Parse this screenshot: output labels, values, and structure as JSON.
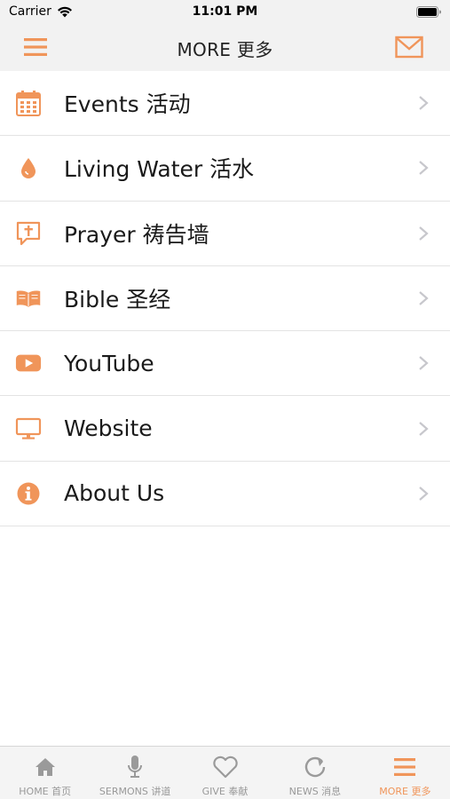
{
  "status": {
    "carrier": "Carrier",
    "time": "11:01 PM"
  },
  "header": {
    "title": "MORE 更多",
    "left_icon": "hamburger-menu-icon",
    "right_icon": "mail-icon"
  },
  "colors": {
    "accent": "#f0955a",
    "inactive": "#999999",
    "chevron": "#c7c7cc"
  },
  "menu": [
    {
      "label": "Events 活动",
      "icon": "calendar-icon"
    },
    {
      "label": "Living Water 活水",
      "icon": "water-drop-icon"
    },
    {
      "label": "Prayer 祷告墙",
      "icon": "prayer-chat-icon"
    },
    {
      "label": "Bible 圣经",
      "icon": "open-book-icon"
    },
    {
      "label": "YouTube",
      "icon": "youtube-icon"
    },
    {
      "label": "Website",
      "icon": "monitor-icon"
    },
    {
      "label": "About Us",
      "icon": "info-icon"
    }
  ],
  "tabs": [
    {
      "label": "HOME 首页",
      "icon": "home-icon",
      "active": false
    },
    {
      "label": "SERMONS 讲道",
      "icon": "microphone-icon",
      "active": false
    },
    {
      "label": "GIVE 奉献",
      "icon": "heart-icon",
      "active": false
    },
    {
      "label": "NEWS 消息",
      "icon": "refresh-icon",
      "active": false
    },
    {
      "label": "MORE 更多",
      "icon": "hamburger-menu-icon",
      "active": true
    }
  ]
}
